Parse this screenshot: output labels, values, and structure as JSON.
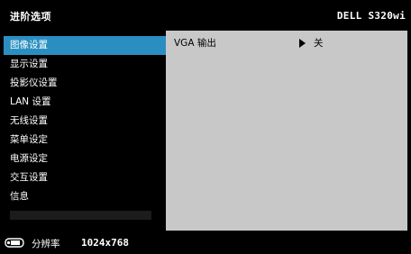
{
  "header": {
    "title": "进阶选项",
    "model": "DELL S320wi"
  },
  "sidebar": {
    "items": [
      {
        "label": "图像设置",
        "active": true
      },
      {
        "label": "显示设置",
        "active": false
      },
      {
        "label": "投影仪设置",
        "active": false
      },
      {
        "label": "LAN 设置",
        "active": false
      },
      {
        "label": "无线设置",
        "active": false
      },
      {
        "label": "菜单设定",
        "active": false
      },
      {
        "label": "电源设定",
        "active": false
      },
      {
        "label": "交互设置",
        "active": false
      },
      {
        "label": "信息",
        "active": false
      }
    ]
  },
  "content": {
    "rows": [
      {
        "label": "VGA 输出",
        "value": "关"
      }
    ]
  },
  "footer": {
    "label": "分辨率",
    "value": "1024x768",
    "icon": "projector-icon"
  },
  "colors": {
    "background": "#000000",
    "active_item": "#2a8fc0",
    "content_panel": "#c8c8c8",
    "text": "#ffffff"
  }
}
